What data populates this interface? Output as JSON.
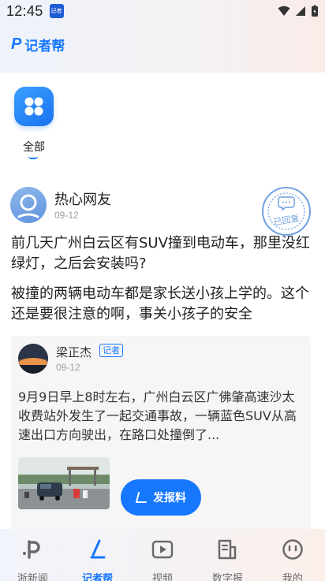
{
  "status": {
    "time": "12:45",
    "app_icon_text": "記者"
  },
  "header": {
    "brand_mark": "P",
    "brand_name": "记者帮"
  },
  "category": {
    "label": "全部"
  },
  "post": {
    "user_name": "热心网友",
    "date": "09-12",
    "stamp_text": "已回复",
    "question": "前几天广州白云区有SUV撞到电动车，那里没红绿灯，之后会安装吗?",
    "detail": "被撞的两辆电动车都是家长送小孩上学的。这个还是要很注意的啊，事关小孩子的安全"
  },
  "reply": {
    "name": "梁正杰",
    "badge": "记者",
    "date": "09-12",
    "text": "9月9日早上8时左右，广州白云区广佛肇高速沙太收费站外发生了一起交通事故，一辆蓝色SUV从高速出口方向驶出，在路口处撞倒了...",
    "report_button": "发报料"
  },
  "tabs": [
    {
      "label": "浙新闻",
      "icon": "p-logo-icon"
    },
    {
      "label": "记者帮",
      "icon": "slash-pen-icon"
    },
    {
      "label": "视频",
      "icon": "play-icon"
    },
    {
      "label": "数字报",
      "icon": "newspaper-icon"
    },
    {
      "label": "我的",
      "icon": "face-icon"
    }
  ],
  "colors": {
    "accent": "#1677ff",
    "text": "#1f1f1f",
    "muted": "#a0a0a0"
  }
}
